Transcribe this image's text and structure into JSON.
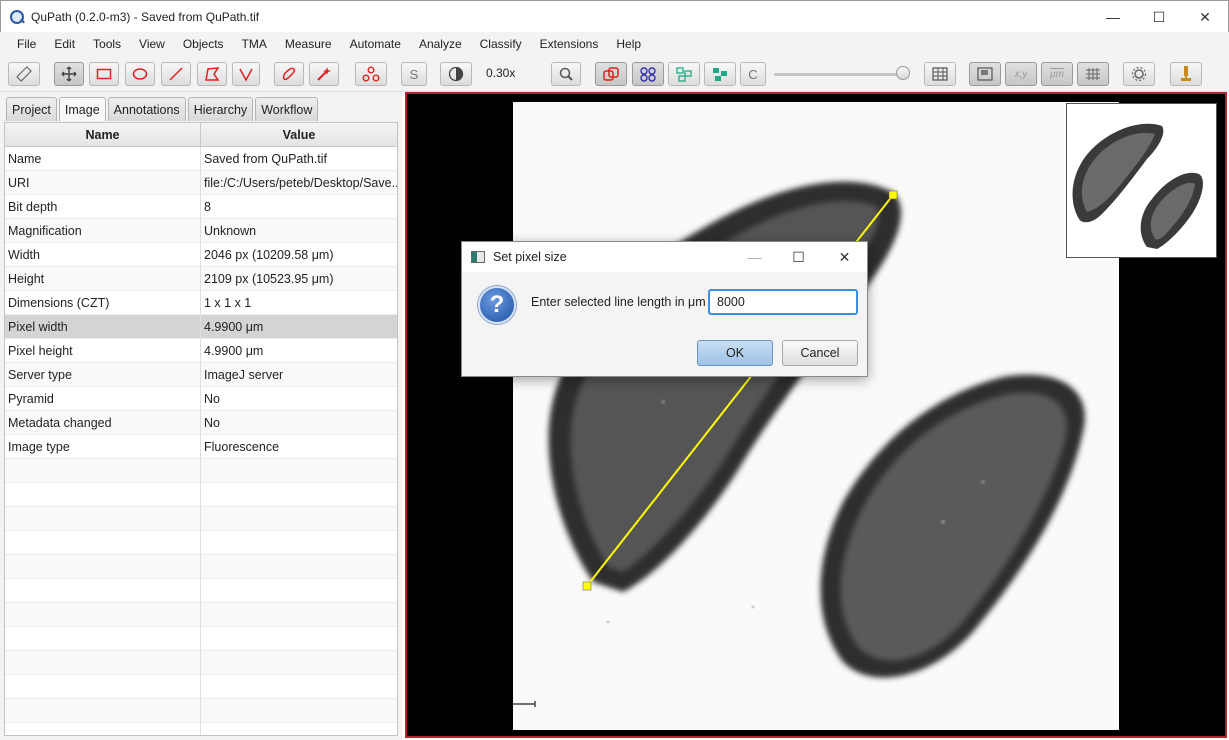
{
  "window": {
    "title": "QuPath (0.2.0-m3) - Saved from QuPath.tif",
    "minimize": "—",
    "maximize": "☐",
    "close": "✕"
  },
  "menu": [
    "File",
    "Edit",
    "Tools",
    "View",
    "Objects",
    "TMA",
    "Measure",
    "Automate",
    "Analyze",
    "Classify",
    "Extensions",
    "Help"
  ],
  "toolbar": {
    "zoom_label": "0.30x",
    "s_label": "S",
    "c_label": "C",
    "xy_label": "x,y",
    "um_label": "μm"
  },
  "tabs": [
    {
      "label": "Project"
    },
    {
      "label": "Image"
    },
    {
      "label": "Annotations"
    },
    {
      "label": "Hierarchy"
    },
    {
      "label": "Workflow"
    }
  ],
  "table": {
    "headers": {
      "name": "Name",
      "value": "Value"
    },
    "rows": [
      {
        "name": "Name",
        "value": "Saved from QuPath.tif"
      },
      {
        "name": "URI",
        "value": "file:/C:/Users/peteb/Desktop/Save..."
      },
      {
        "name": "Bit depth",
        "value": "8"
      },
      {
        "name": "Magnification",
        "value": "Unknown"
      },
      {
        "name": "Width",
        "value": "2046 px (10209.58 μm)"
      },
      {
        "name": "Height",
        "value": "2109 px (10523.95 μm)"
      },
      {
        "name": "Dimensions (CZT)",
        "value": "1 x 1 x 1"
      },
      {
        "name": "Pixel width",
        "value": "4.9900 μm"
      },
      {
        "name": "Pixel height",
        "value": "4.9900 μm"
      },
      {
        "name": "Server type",
        "value": "ImageJ server"
      },
      {
        "name": "Pyramid",
        "value": "No"
      },
      {
        "name": "Metadata changed",
        "value": "No"
      },
      {
        "name": "Image type",
        "value": "Fluorescence"
      }
    ]
  },
  "dialog": {
    "title": "Set pixel size",
    "prompt": "Enter selected line length in μm",
    "input_value": "8000",
    "ok_label": "OK",
    "cancel_label": "Cancel",
    "question_mark": "?"
  },
  "colors": {
    "viewer_border": "#b8252d",
    "line_annotation": "#ffff00",
    "ok_button": "#9dc2e8"
  }
}
